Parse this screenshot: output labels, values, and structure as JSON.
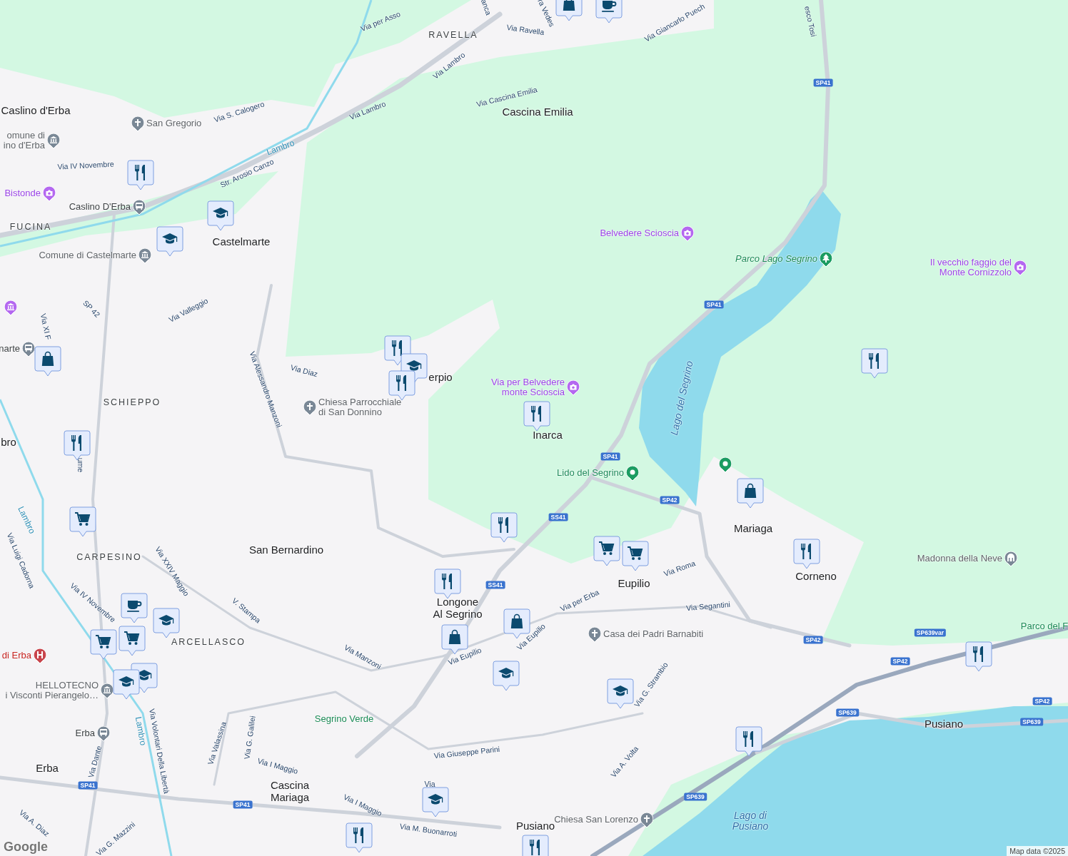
{
  "map": {
    "places": [
      {
        "name": "Caslino d'Erba",
        "kind": "town"
      },
      {
        "name": "RAVELLA",
        "kind": "district"
      },
      {
        "name": "Cascina Emilia",
        "kind": "town"
      },
      {
        "name": "FUCINA",
        "kind": "district"
      },
      {
        "name": "Castelmarte",
        "kind": "town"
      },
      {
        "name": "erpio",
        "kind": "town"
      },
      {
        "name": "SCHIEPPO",
        "kind": "district"
      },
      {
        "name": "Inarca",
        "kind": "town"
      },
      {
        "name": "bro",
        "kind": "town"
      },
      {
        "name": "Mariaga",
        "kind": "town"
      },
      {
        "name": "San Bernardino",
        "kind": "town"
      },
      {
        "name": "CARPESINO",
        "kind": "district"
      },
      {
        "name": "Corneno",
        "kind": "town"
      },
      {
        "name": "Eupilio",
        "kind": "town"
      },
      {
        "name": "Longone\nAl Segrino",
        "kind": "town"
      },
      {
        "name": "ARCELLASCO",
        "kind": "district"
      },
      {
        "name": "Pusiano",
        "kind": "town"
      },
      {
        "name": "Erba",
        "kind": "town"
      },
      {
        "name": "Cascina\nMariaga",
        "kind": "town"
      },
      {
        "name": "Pusiano",
        "kind": "town"
      }
    ],
    "pois": [
      {
        "kind": "church",
        "lines": [
          "San Gregorio"
        ]
      },
      {
        "kind": "townhall",
        "lines": [
          "omune di",
          "ino d'Erba"
        ]
      },
      {
        "kind": "photo",
        "lines": [
          "Bistonde"
        ]
      },
      {
        "kind": "station",
        "lines": [
          "Caslino D'Erba"
        ]
      },
      {
        "kind": "townhall",
        "lines": [
          "Comune di Castelmarte"
        ]
      },
      {
        "kind": "museum"
      },
      {
        "kind": "station",
        "lines": [
          "narte"
        ]
      },
      {
        "kind": "church",
        "lines": [
          "Chiesa Parrocchiale",
          "di San Donnino"
        ]
      },
      {
        "kind": "photo",
        "lines": [
          "Belvedere Scioscia"
        ]
      },
      {
        "kind": "park",
        "lines": [
          "Parco Lago Segrino"
        ]
      },
      {
        "kind": "photo",
        "lines": [
          "Il vecchio faggio del",
          "Monte Cornizzolo"
        ]
      },
      {
        "kind": "photo",
        "lines": [
          "Via per Belvedere",
          "monte Scioscia"
        ]
      },
      {
        "kind": "pin",
        "lines": [
          "Lido del Segrino"
        ]
      },
      {
        "kind": "pin"
      },
      {
        "kind": "monument",
        "lines": [
          "Madonna della Neve"
        ]
      },
      {
        "kind": "church",
        "lines": [
          "Casa dei Padri Barnabiti"
        ]
      },
      {
        "kind": "hospital",
        "lines": [
          "di Erba"
        ]
      },
      {
        "kind": "townhall",
        "lines": [
          "HELLOTECNO",
          "i Visconti Pierangelo…"
        ]
      },
      {
        "kind": "station",
        "lines": [
          "Erba"
        ]
      },
      {
        "kind": "church",
        "lines": [
          "Chiesa San Lorenzo"
        ]
      }
    ],
    "features": [
      {
        "kind": "river",
        "name": "Lambro"
      },
      {
        "kind": "river",
        "name": "Lambro"
      },
      {
        "kind": "river",
        "name": "Lambro"
      },
      {
        "kind": "lake",
        "name": "Lago del Segrino"
      },
      {
        "kind": "park",
        "name": "Segrino Verde"
      },
      {
        "kind": "lake",
        "name": "Lago di\nPusiano"
      },
      {
        "kind": "park",
        "name": "Parco del F"
      }
    ],
    "streets": [
      "Via per Asso",
      "anca",
      "ra Vedes",
      "Via Ravella",
      "Via Giancarlo Puech",
      "esco Tosi",
      "Via Lambro",
      "Via Lambro",
      "Via Cascina Emilia",
      "Via S. Calogero",
      "Via IV Novembre",
      "Str. Arosio Canzo",
      "SP 42",
      "Via Valleggio",
      "Via XI F",
      "Via Diaz",
      "Via Alessandro Manzoni",
      "ume",
      "Via Luigi Cadorna",
      "Via XXIV Maggio",
      "Via IV Novembre",
      "V. Stampa",
      "Via Manzoni",
      "Via Eupilio",
      "Via Eupilio",
      "Via per Erba",
      "Via Roma",
      "Via Segantini",
      "Via G. Strambio",
      "Via Valassina",
      "Via G. Galilei",
      "Via Volontari Della Libertà",
      "Via Dante",
      "Via Giuseppe Parini",
      "Via I Maggio",
      "Via A. Volta",
      "Via",
      "Via I Maggio",
      "Via M. Buonarroti",
      "Via A. Diaz",
      "Via G. Mazzini"
    ],
    "road_shields": [
      "SP41",
      "SP41",
      "SP41",
      "SS41",
      "SP42",
      "SS41",
      "SP42",
      "SP639var",
      "SP42",
      "SP42",
      "SP639",
      "SP639",
      "SP639",
      "SP41",
      "SP41"
    ],
    "markers": [
      {
        "kind": "shop"
      },
      {
        "kind": "cafe"
      },
      {
        "kind": "restaurant"
      },
      {
        "kind": "school"
      },
      {
        "kind": "school"
      },
      {
        "kind": "shop"
      },
      {
        "kind": "restaurant"
      },
      {
        "kind": "school"
      },
      {
        "kind": "restaurant"
      },
      {
        "kind": "restaurant"
      },
      {
        "kind": "restaurant"
      },
      {
        "kind": "cart"
      },
      {
        "kind": "restaurant"
      },
      {
        "kind": "cart"
      },
      {
        "kind": "cart"
      },
      {
        "kind": "shop"
      },
      {
        "kind": "restaurant"
      },
      {
        "kind": "restaurant"
      },
      {
        "kind": "restaurant"
      },
      {
        "kind": "shop"
      },
      {
        "kind": "shop"
      },
      {
        "kind": "cafe"
      },
      {
        "kind": "school"
      },
      {
        "kind": "cart"
      },
      {
        "kind": "cart"
      },
      {
        "kind": "school"
      },
      {
        "kind": "school"
      },
      {
        "kind": "school"
      },
      {
        "kind": "school"
      },
      {
        "kind": "restaurant"
      },
      {
        "kind": "restaurant"
      },
      {
        "kind": "school"
      },
      {
        "kind": "restaurant"
      },
      {
        "kind": "restaurant"
      }
    ],
    "attribution": "Map data ©2025"
  },
  "logo": "Google"
}
